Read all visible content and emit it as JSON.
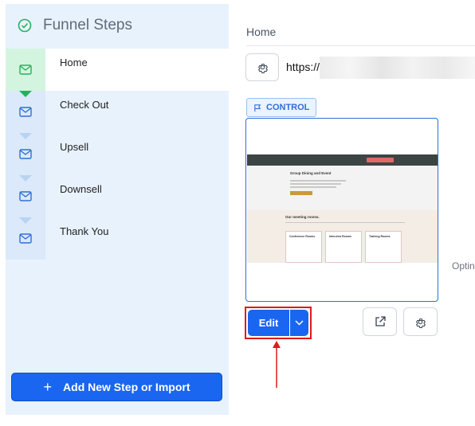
{
  "sidebar": {
    "title": "Funnel Steps",
    "steps": [
      {
        "label": "Home",
        "active": true
      },
      {
        "label": "Check Out",
        "active": false
      },
      {
        "label": "Upsell",
        "active": false
      },
      {
        "label": "Downsell",
        "active": false
      },
      {
        "label": "Thank You",
        "active": false
      }
    ],
    "add_button_label": "Add New Step or Import",
    "add_button_icon": "plus-icon"
  },
  "main": {
    "page_title": "Home",
    "url_prefix": "https://",
    "control_tag": "CONTROL",
    "preview": {
      "hero_heading": "Group Dining and Event",
      "section_heading": "Our meeting rooms.",
      "cards": [
        "Conference Rooms",
        "Interview Rooms",
        "Training Rooms"
      ]
    },
    "side_text": "Optin",
    "edit_label": "Edit"
  },
  "colors": {
    "primary": "#1a66f0",
    "active_green": "#22b35e",
    "annotation_red": "#e11919",
    "sidebar_bg": "#e8f2fd"
  }
}
